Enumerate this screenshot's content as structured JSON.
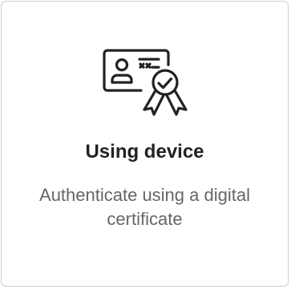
{
  "card": {
    "icon": "certificate-device-icon",
    "title": "Using device",
    "description": "Authenticate using a digital certificate"
  },
  "colors": {
    "border": "#cfcfcf",
    "title": "#222222",
    "description": "#666666",
    "icon": "#222222"
  }
}
